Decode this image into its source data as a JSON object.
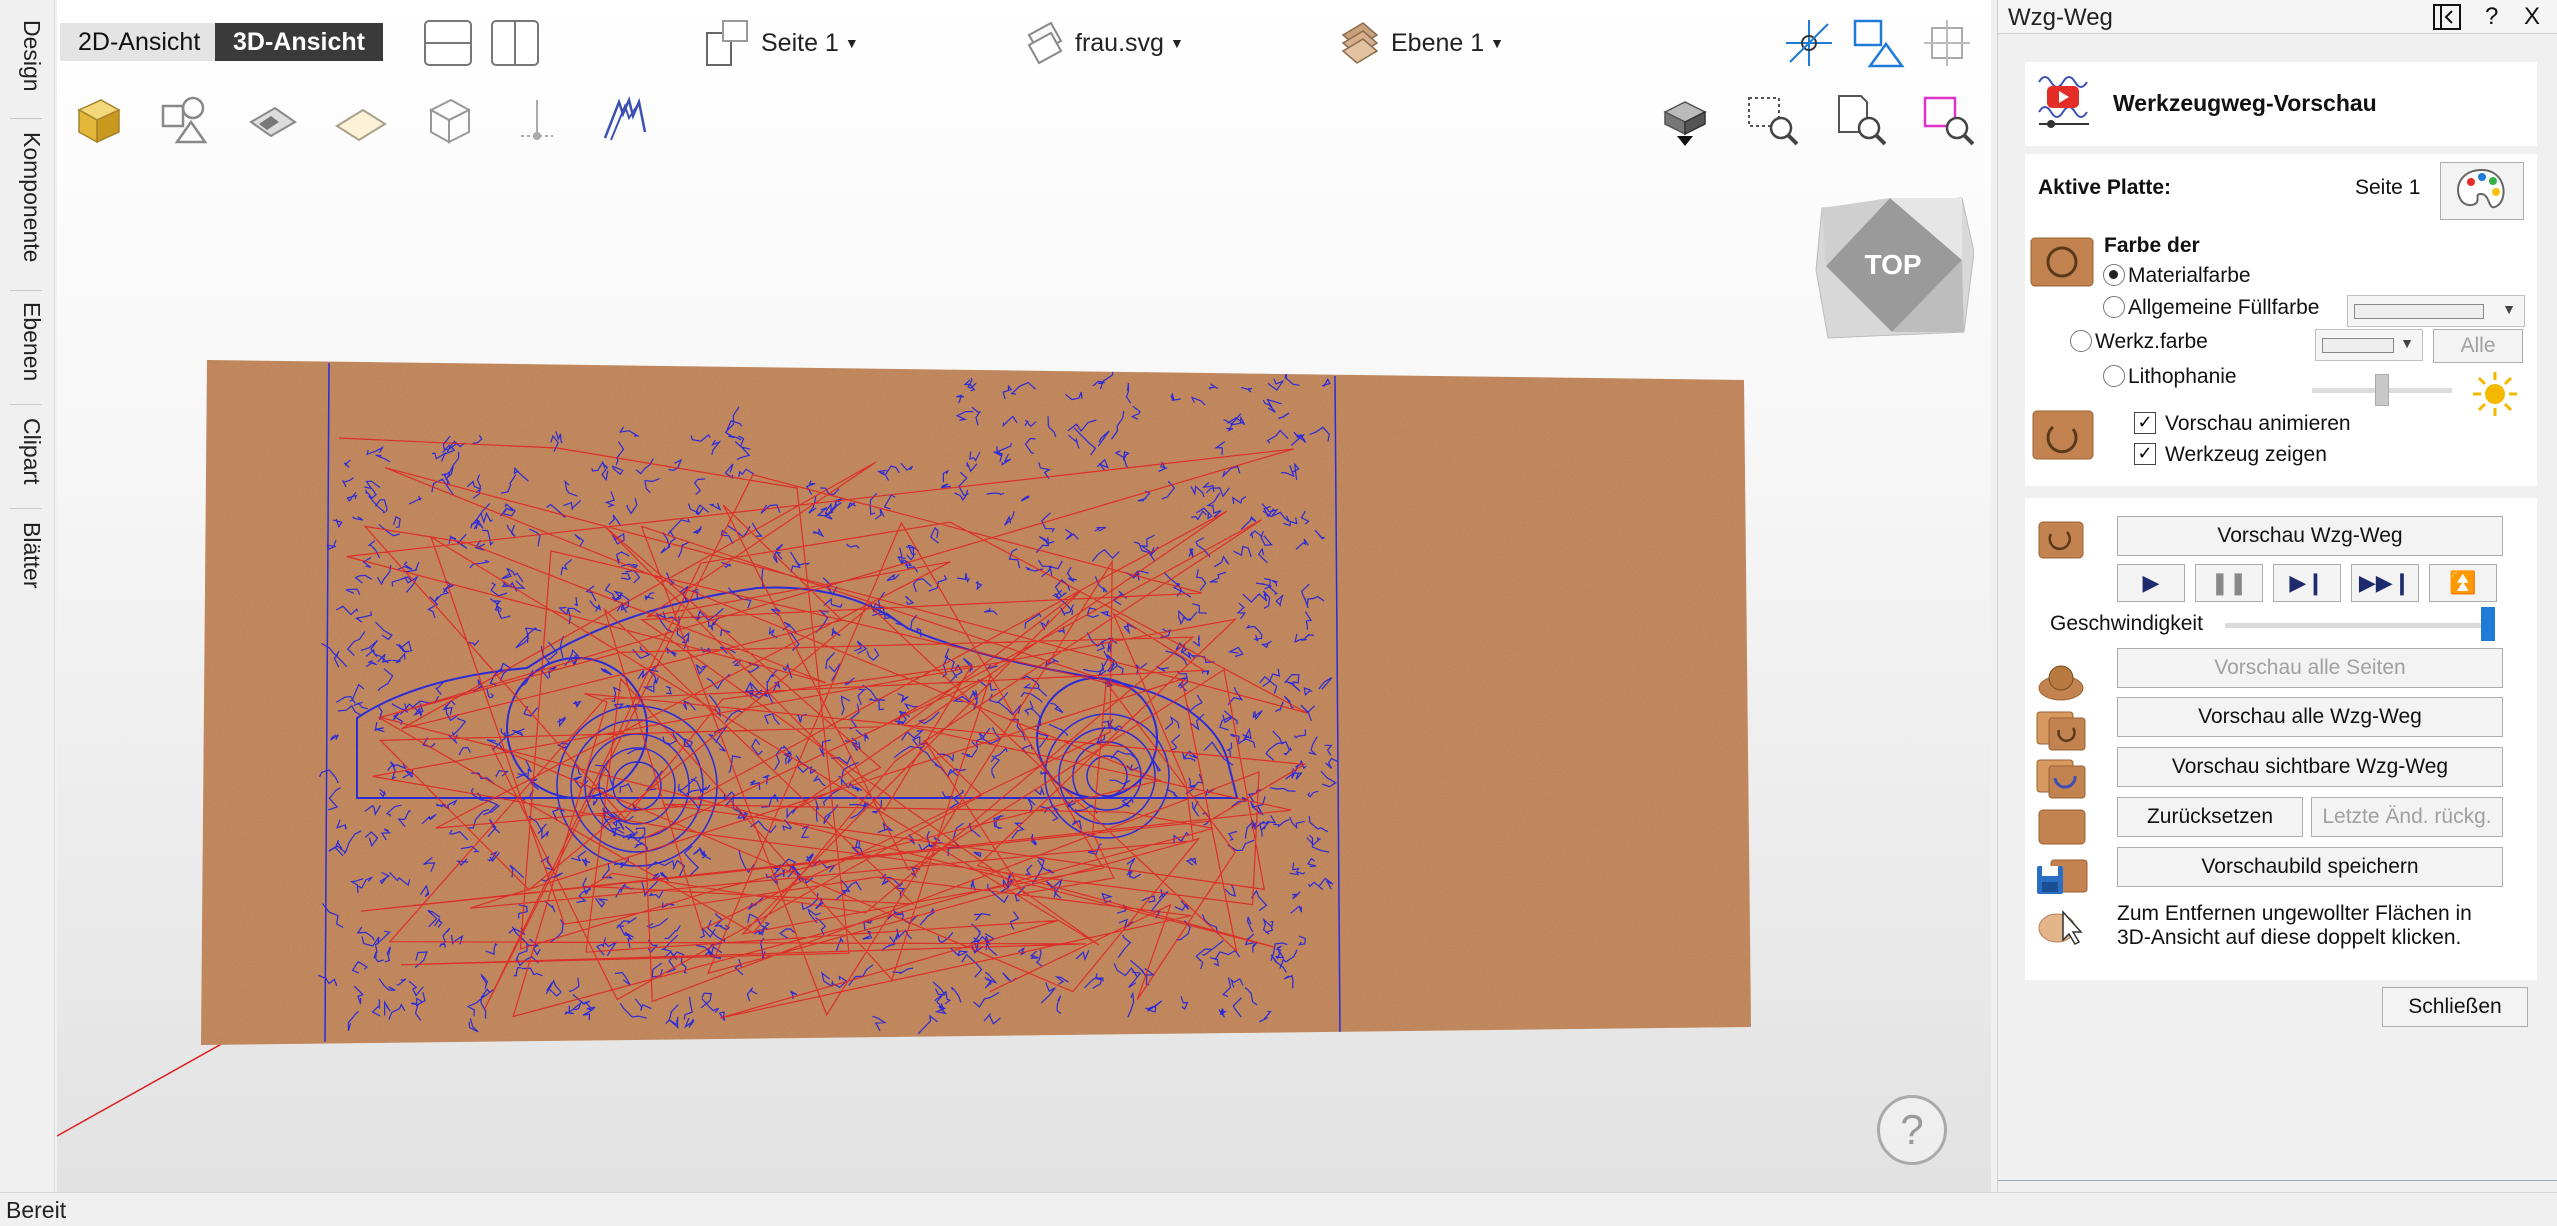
{
  "left_tabs": [
    "Design",
    "Komponente",
    "Ebenen",
    "Clipart",
    "Blätter"
  ],
  "toolbar": {
    "view_2d": "2D-Ansicht",
    "view_3d": "3D-Ansicht",
    "page_dropdown": "Seite 1",
    "file_dropdown": "frau.svg",
    "layer_dropdown": "Ebene 1"
  },
  "viewcube": {
    "label": "TOP"
  },
  "help": "?",
  "panel": {
    "title": "Wzg-Weg",
    "header_buttons": {
      "help": "?",
      "close": "X"
    },
    "heading": "Werkzeugweg-Vorschau",
    "active_plate_label": "Aktive Platte:",
    "active_plate_value": "Seite 1",
    "color_group_label": "Farbe der",
    "options": {
      "material_color": "Materialfarbe",
      "general_fill": "Allgemeine Füllfarbe",
      "tool_color": "Werkz.farbe",
      "tool_color_all": "Alle",
      "lithophane": "Lithophanie",
      "animate_preview": "Vorschau animieren",
      "show_tool": "Werkzeug zeigen"
    },
    "selected_color_option": "Materialfarbe",
    "animate_checked": true,
    "show_tool_checked": true,
    "preview_toolpath": "Vorschau Wzg-Weg",
    "playback": [
      "play-icon",
      "pause-icon",
      "step-icon",
      "fast-forward-icon",
      "jump-to-top-icon"
    ],
    "speed_label": "Geschwindigkeit",
    "speed_value": 1.0,
    "preview_all_pages": "Vorschau alle Seiten",
    "preview_all_toolpaths": "Vorschau alle Wzg-Weg",
    "preview_visible_toolpaths": "Vorschau sichtbare Wzg-Weg",
    "reset": "Zurücksetzen",
    "undo_last": "Letzte Änd. rückg.",
    "save_preview": "Vorschaubild speichern",
    "hint_line1": "Zum Entfernen ungewollter Flächen in",
    "hint_line2": "3D-Ansicht auf diese doppelt klicken.",
    "close": "Schließen"
  },
  "status": "Bereit",
  "colors": {
    "active_view": "#3a3a3a",
    "accent_blue": "#1e7bd8",
    "toolpath_blue": "#2b2bd8",
    "toolpath_red": "#e02020",
    "wood": "#c99065",
    "speed_slider": "#1e7bd8"
  }
}
